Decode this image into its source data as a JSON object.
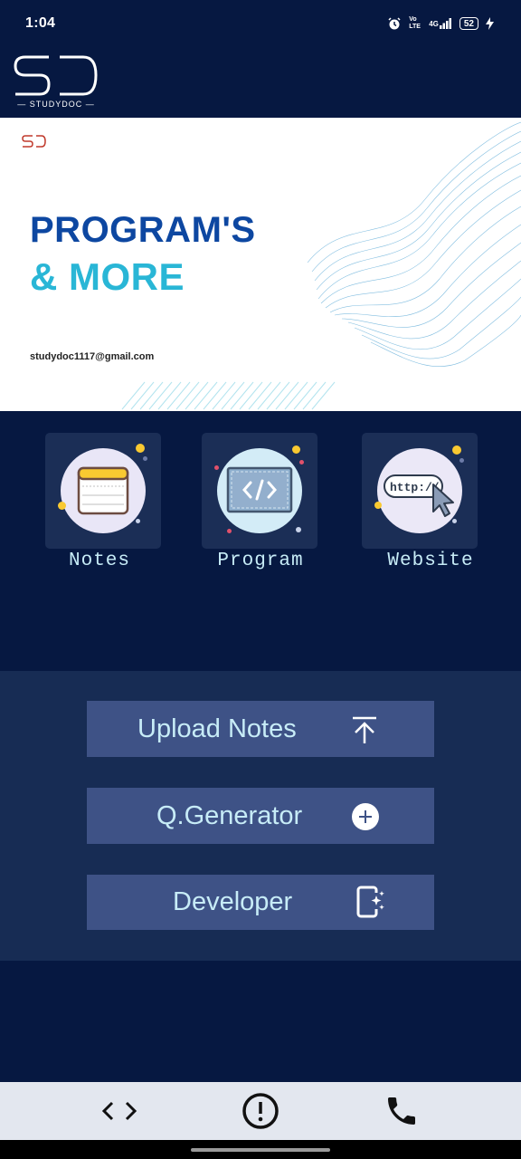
{
  "status": {
    "time": "1:04",
    "network": "4G",
    "volte": "Vo LTE",
    "battery": "52"
  },
  "logo": {
    "mark": "SD",
    "caption": "STUDYDOC"
  },
  "banner": {
    "headline_line1": "PROGRAM'S",
    "headline_line2": "& MORE",
    "email": "studydoc1117@gmail.com",
    "colors": {
      "primary": "#0d47a1",
      "accent": "#29b6d6"
    }
  },
  "categories": [
    {
      "label": "Notes",
      "icon": "notes-icon"
    },
    {
      "label": "Program",
      "icon": "code-icon"
    },
    {
      "label": "Website",
      "icon": "http-icon",
      "icon_text": "http://"
    }
  ],
  "actions": [
    {
      "label": "Upload Notes",
      "icon": "upload-icon"
    },
    {
      "label": "Q.Generator",
      "icon": "add-circle-icon"
    },
    {
      "label": "Developer",
      "icon": "developer-icon"
    }
  ],
  "bottom_nav": [
    {
      "name": "code-icon"
    },
    {
      "name": "info-icon"
    },
    {
      "name": "phone-icon"
    }
  ],
  "theme": {
    "background": "#061841",
    "panel": "#172c54",
    "button": "#3e5286",
    "label_text": "#c7ecf7"
  }
}
